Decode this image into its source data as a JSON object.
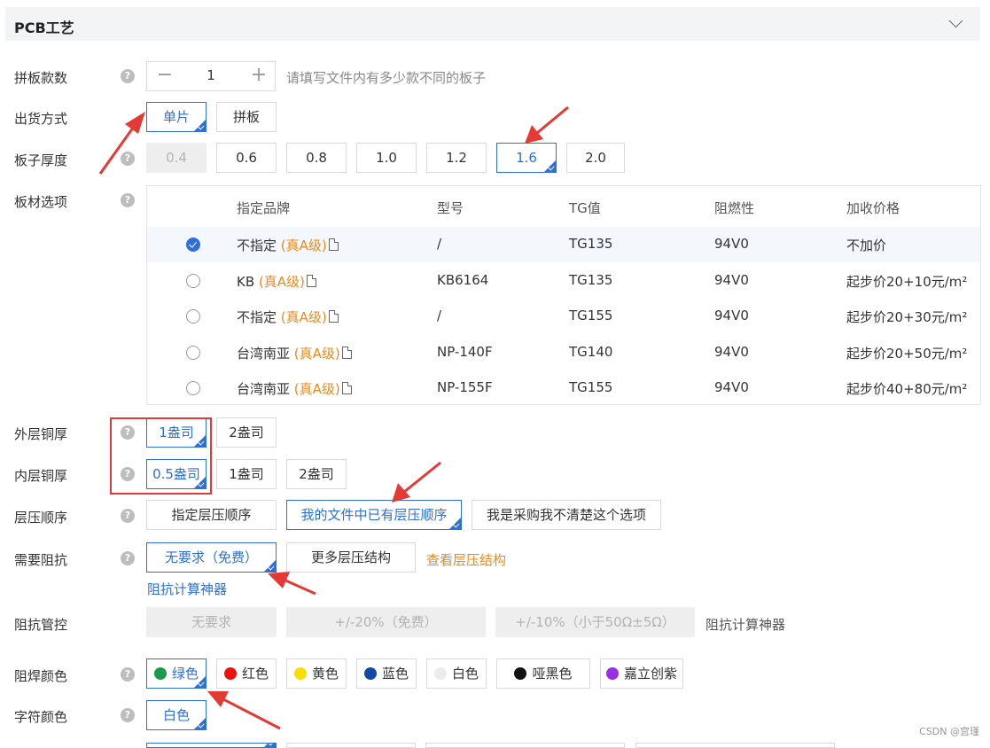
{
  "section": {
    "title": "PCB工艺"
  },
  "panel_count": {
    "label": "拼板款数",
    "value": "1",
    "minus": "−",
    "plus": "+",
    "hint": "请填写文件内有多少款不同的板子"
  },
  "shipping": {
    "label": "出货方式",
    "options": [
      "单片",
      "拼板"
    ],
    "selected": "单片"
  },
  "thickness": {
    "label": "板子厚度",
    "options": [
      "0.4",
      "0.6",
      "0.8",
      "1.0",
      "1.2",
      "1.6",
      "2.0"
    ],
    "selected": "1.6",
    "disabled": "0.4"
  },
  "material": {
    "label": "板材选项",
    "headers": [
      "指定品牌",
      "型号",
      "TG值",
      "阻燃性",
      "加收价格"
    ],
    "rows": [
      {
        "brand": "不指定",
        "grade": "(真A级)",
        "model": "/",
        "tg": "TG135",
        "flame": "94V0",
        "price": "不加价",
        "selected": true
      },
      {
        "brand": "KB",
        "grade": "(真A级)",
        "model": "KB6164",
        "tg": "TG135",
        "flame": "94V0",
        "price": "起步价20+10元/m²",
        "selected": false
      },
      {
        "brand": "不指定",
        "grade": "(真A级)",
        "model": "/",
        "tg": "TG155",
        "flame": "94V0",
        "price": "起步价20+30元/m²",
        "selected": false
      },
      {
        "brand": "台湾南亚",
        "grade": "(真A级)",
        "model": "NP-140F",
        "tg": "TG140",
        "flame": "94V0",
        "price": "起步价20+50元/m²",
        "selected": false
      },
      {
        "brand": "台湾南亚",
        "grade": "(真A级)",
        "model": "NP-155F",
        "tg": "TG155",
        "flame": "94V0",
        "price": "起步价40+80元/m²",
        "selected": false
      }
    ]
  },
  "outer_copper": {
    "label": "外层铜厚",
    "options": [
      "1盎司",
      "2盎司"
    ],
    "selected": "1盎司"
  },
  "inner_copper": {
    "label": "内层铜厚",
    "options": [
      "0.5盎司",
      "1盎司",
      "2盎司"
    ],
    "selected": "0.5盎司"
  },
  "lamination": {
    "label": "层压顺序",
    "options": [
      "指定层压顺序",
      "我的文件中已有层压顺序",
      "我是采购我不清楚这个选项"
    ],
    "selected": "我的文件中已有层压顺序"
  },
  "impedance": {
    "label": "需要阻抗",
    "options": [
      "无要求（免费）",
      "更多层压结构"
    ],
    "selected": "无要求（免费）",
    "view_link": "查看层压结构",
    "calc_link": "阻抗计算神器"
  },
  "impedance_control": {
    "label": "阻抗管控",
    "options": [
      "无要求",
      "+/-20%（免费）",
      "+/-10%（小于50Ω±5Ω）"
    ],
    "extra": "阻抗计算神器"
  },
  "solder_mask": {
    "label": "阻焊颜色",
    "options": [
      {
        "name": "绿色",
        "color": "#1a9a4a"
      },
      {
        "name": "红色",
        "color": "#ee1111"
      },
      {
        "name": "黄色",
        "color": "#f5e000"
      },
      {
        "name": "蓝色",
        "color": "#1448a6"
      },
      {
        "name": "白色",
        "color": "#ececec"
      },
      {
        "name": "哑黑色",
        "color": "#111111"
      },
      {
        "name": "嘉立创紫",
        "color": "#9a2ee6"
      }
    ],
    "selected": "绿色"
  },
  "silkscreen": {
    "label": "字符颜色",
    "options": [
      "白色"
    ],
    "selected": "白色"
  },
  "help_icon": "?",
  "watermark": "CSDN @宫瑾"
}
